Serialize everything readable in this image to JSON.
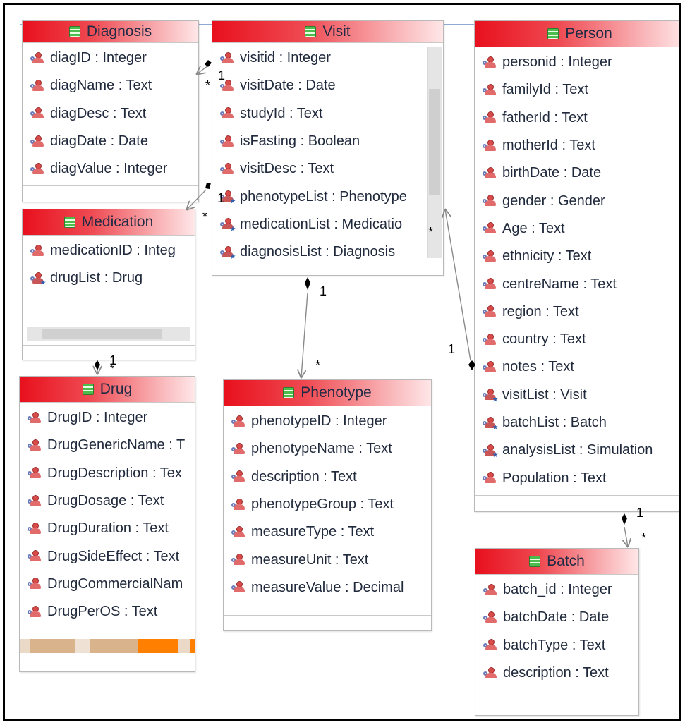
{
  "diagram": {
    "entities": {
      "diagnosis": {
        "name": "Diagnosis",
        "attributes": [
          {
            "text": "diagID : Integer",
            "kind": "attr"
          },
          {
            "text": "diagName : Text",
            "kind": "attr"
          },
          {
            "text": "diagDesc : Text",
            "kind": "attr"
          },
          {
            "text": "diagDate : Date",
            "kind": "attr"
          },
          {
            "text": "diagValue : Integer",
            "kind": "attr"
          }
        ]
      },
      "visit": {
        "name": "Visit",
        "attributes": [
          {
            "text": "visitid : Integer",
            "kind": "attr"
          },
          {
            "text": "visitDate : Date",
            "kind": "attr"
          },
          {
            "text": "studyId : Text",
            "kind": "attr"
          },
          {
            "text": "isFasting : Boolean",
            "kind": "attr"
          },
          {
            "text": "visitDesc : Text",
            "kind": "attr"
          },
          {
            "text": "phenotypeList : Phenotype",
            "kind": "collection"
          },
          {
            "text": "medicationList : Medicatio",
            "kind": "collection"
          },
          {
            "text": "diagnosisList : Diagnosis",
            "kind": "collection"
          }
        ]
      },
      "person": {
        "name": "Person",
        "attributes": [
          {
            "text": "personid : Integer",
            "kind": "attr"
          },
          {
            "text": "familyId : Text",
            "kind": "attr"
          },
          {
            "text": "fatherId : Text",
            "kind": "attr"
          },
          {
            "text": "motherId : Text",
            "kind": "attr"
          },
          {
            "text": "birthDate : Date",
            "kind": "attr"
          },
          {
            "text": "gender : Gender",
            "kind": "attr"
          },
          {
            "text": "Age : Text",
            "kind": "attr"
          },
          {
            "text": "ethnicity : Text",
            "kind": "attr"
          },
          {
            "text": "centreName : Text",
            "kind": "attr"
          },
          {
            "text": "region : Text",
            "kind": "attr"
          },
          {
            "text": "country : Text",
            "kind": "attr"
          },
          {
            "text": "notes  : Text",
            "kind": "attr"
          },
          {
            "text": "visitList : Visit",
            "kind": "collection"
          },
          {
            "text": "batchList : Batch",
            "kind": "collection"
          },
          {
            "text": "analysisList : Simulation",
            "kind": "collection"
          },
          {
            "text": "Population : Text",
            "kind": "attr"
          }
        ]
      },
      "medication": {
        "name": "Medication",
        "attributes": [
          {
            "text": "medicationID : Integ",
            "kind": "attr"
          },
          {
            "text": "drugList : Drug",
            "kind": "collection"
          }
        ]
      },
      "drug": {
        "name": "Drug",
        "attributes": [
          {
            "text": "DrugID : Integer",
            "kind": "attr"
          },
          {
            "text": "DrugGenericName : T",
            "kind": "attr"
          },
          {
            "text": "DrugDescription : Tex",
            "kind": "attr"
          },
          {
            "text": "DrugDosage : Text",
            "kind": "attr"
          },
          {
            "text": "DrugDuration : Text",
            "kind": "attr"
          },
          {
            "text": "DrugSideEffect : Text",
            "kind": "attr"
          },
          {
            "text": "DrugCommercialNam",
            "kind": "attr"
          },
          {
            "text": "DrugPerOS : Text",
            "kind": "attr"
          }
        ]
      },
      "phenotype": {
        "name": "Phenotype",
        "attributes": [
          {
            "text": "phenotypeID : Integer",
            "kind": "attr"
          },
          {
            "text": "phenotypeName : Text",
            "kind": "attr"
          },
          {
            "text": "description : Text",
            "kind": "attr"
          },
          {
            "text": "phenotypeGroup : Text",
            "kind": "attr"
          },
          {
            "text": "measureType : Text",
            "kind": "attr"
          },
          {
            "text": "measureUnit : Text",
            "kind": "attr"
          },
          {
            "text": "measureValue : Decimal",
            "kind": "attr"
          }
        ]
      },
      "batch": {
        "name": "Batch",
        "attributes": [
          {
            "text": " batch_id : Integer",
            "kind": "attr"
          },
          {
            "text": "batchDate : Date",
            "kind": "attr"
          },
          {
            "text": "batchType : Text",
            "kind": "attr"
          },
          {
            "text": "description : Text",
            "kind": "attr"
          }
        ]
      }
    },
    "multiplicities": {
      "visit_diag_one": "1",
      "visit_diag_many": "*",
      "visit_med_one": "1",
      "visit_med_many": "*",
      "med_drug_one": "1",
      "med_drug_many": "*",
      "visit_pheno_one": "1",
      "visit_pheno_many": "*",
      "person_visit_one": "1",
      "person_visit_many": "*",
      "person_batch_one": "1",
      "person_batch_many": "*"
    },
    "colors": {
      "header_red": "#e8101d",
      "header_fade": "#ffe7e8",
      "border": "#b9b9b9",
      "connector": "#8a8a8a",
      "attr_icon": "#d84b4b",
      "collection_star": "#2e5fb0",
      "scroll_orange": "#ff8000",
      "scroll_tan": "#d9b38c"
    }
  }
}
